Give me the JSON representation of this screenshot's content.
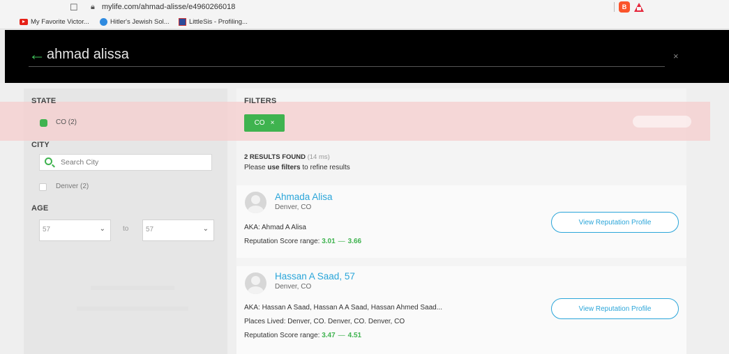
{
  "browser": {
    "url": "mylife.com/ahmad-alisse/e4960266018",
    "bookmarks": [
      "My Favorite Victor...",
      "Hitler's Jewish Sol...",
      "LittleSis - Profiling..."
    ]
  },
  "search": {
    "query": "ahmad alissa",
    "close_label": "×"
  },
  "sidebar": {
    "state_heading": "STATE",
    "state_option": "CO (2)",
    "city_heading": "CITY",
    "city_placeholder": "Search City",
    "city_option": "Denver (2)",
    "age_heading": "AGE",
    "age_from": "57",
    "age_to_label": "to",
    "age_to": "57"
  },
  "filters": {
    "heading": "FILTERS",
    "chip_label": "CO",
    "chip_remove": "×"
  },
  "results": {
    "count_label": "2 RESULTS FOUND",
    "time_label": "(14 ms)",
    "hint_pre": "Please ",
    "hint_bold": "use filters",
    "hint_post": " to refine results",
    "items": [
      {
        "name": "Ahmada Alisa",
        "location": "Denver, CO",
        "aka": "AKA: Ahmad A Alisa",
        "score_label": "Reputation Score range: ",
        "score_low": "3.01",
        "score_high": "3.66",
        "button": "View Reputation Profile"
      },
      {
        "name": "Hassan A Saad, 57",
        "location": "Denver, CO",
        "aka": "AKA: Hassan A Saad, Hassan A A Saad, Hassan Ahmed Saad...",
        "places": "Places Lived: Denver, CO. Denver, CO. Denver, CO",
        "score_label": "Reputation Score range: ",
        "score_low": "3.47",
        "score_high": "4.51",
        "button": "View Reputation Profile"
      }
    ]
  },
  "colors": {
    "accent_green": "#3fb34f",
    "link_blue": "#2aa5d9"
  }
}
